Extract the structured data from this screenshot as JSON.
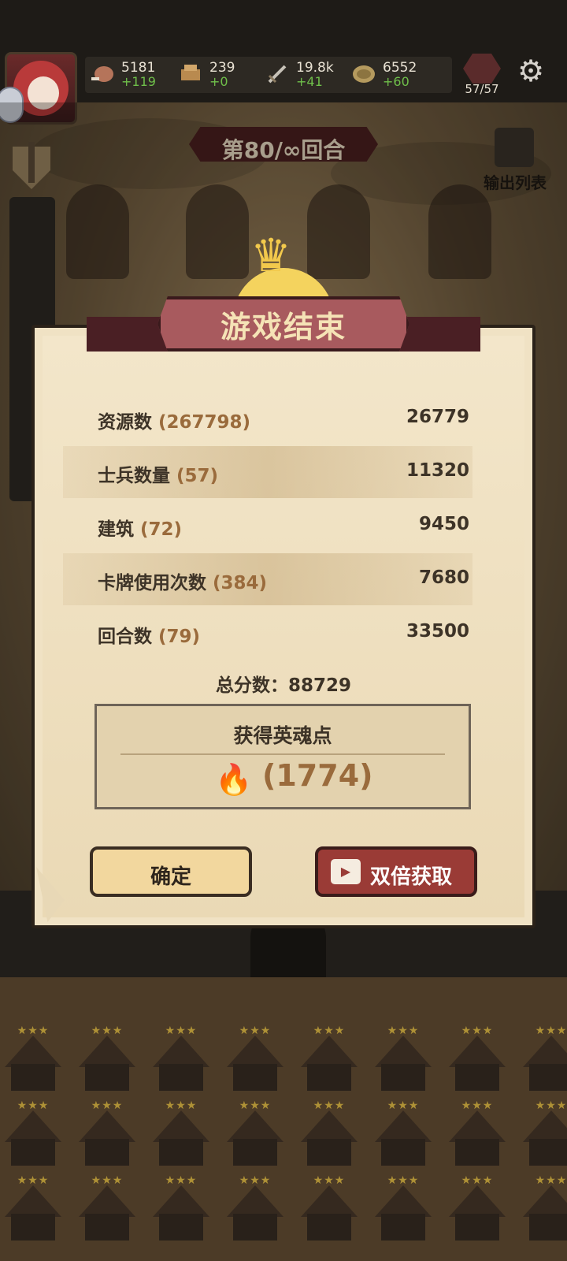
{
  "top_bar": {
    "resources": [
      {
        "icon": "meat-icon",
        "value": "5181",
        "increment": "+119"
      },
      {
        "icon": "wood-icon",
        "value": "239",
        "increment": "+0"
      },
      {
        "icon": "sword-icon",
        "value": "19.8k",
        "increment": "+41"
      },
      {
        "icon": "coin-icon",
        "value": "6552",
        "increment": "+60"
      }
    ],
    "soldiers": "57/57",
    "settings_icon": "gear-icon"
  },
  "round": {
    "label": "第80/∞回合"
  },
  "output_list": {
    "label": "输出列表"
  },
  "modal": {
    "title": "游戏结束",
    "rows": [
      {
        "label": "资源数",
        "count": "(267798)",
        "score": "26779"
      },
      {
        "label": "士兵数量",
        "count": "(57)",
        "score": "11320"
      },
      {
        "label": "建筑",
        "count": "(72)",
        "score": "9450"
      },
      {
        "label": "卡牌使用次数",
        "count": "(384)",
        "score": "7680"
      },
      {
        "label": "回合数",
        "count": "(79)",
        "score": "33500"
      }
    ],
    "total": "总分数：88729",
    "soul": {
      "header": "获得英魂点",
      "points": "(1774)"
    },
    "buttons": {
      "confirm": "确定",
      "double": "双倍获取"
    }
  },
  "colors": {
    "accent_red": "#9a3b36",
    "score_brown": "#9a6b3c",
    "increment_green": "#6fbf4a"
  }
}
